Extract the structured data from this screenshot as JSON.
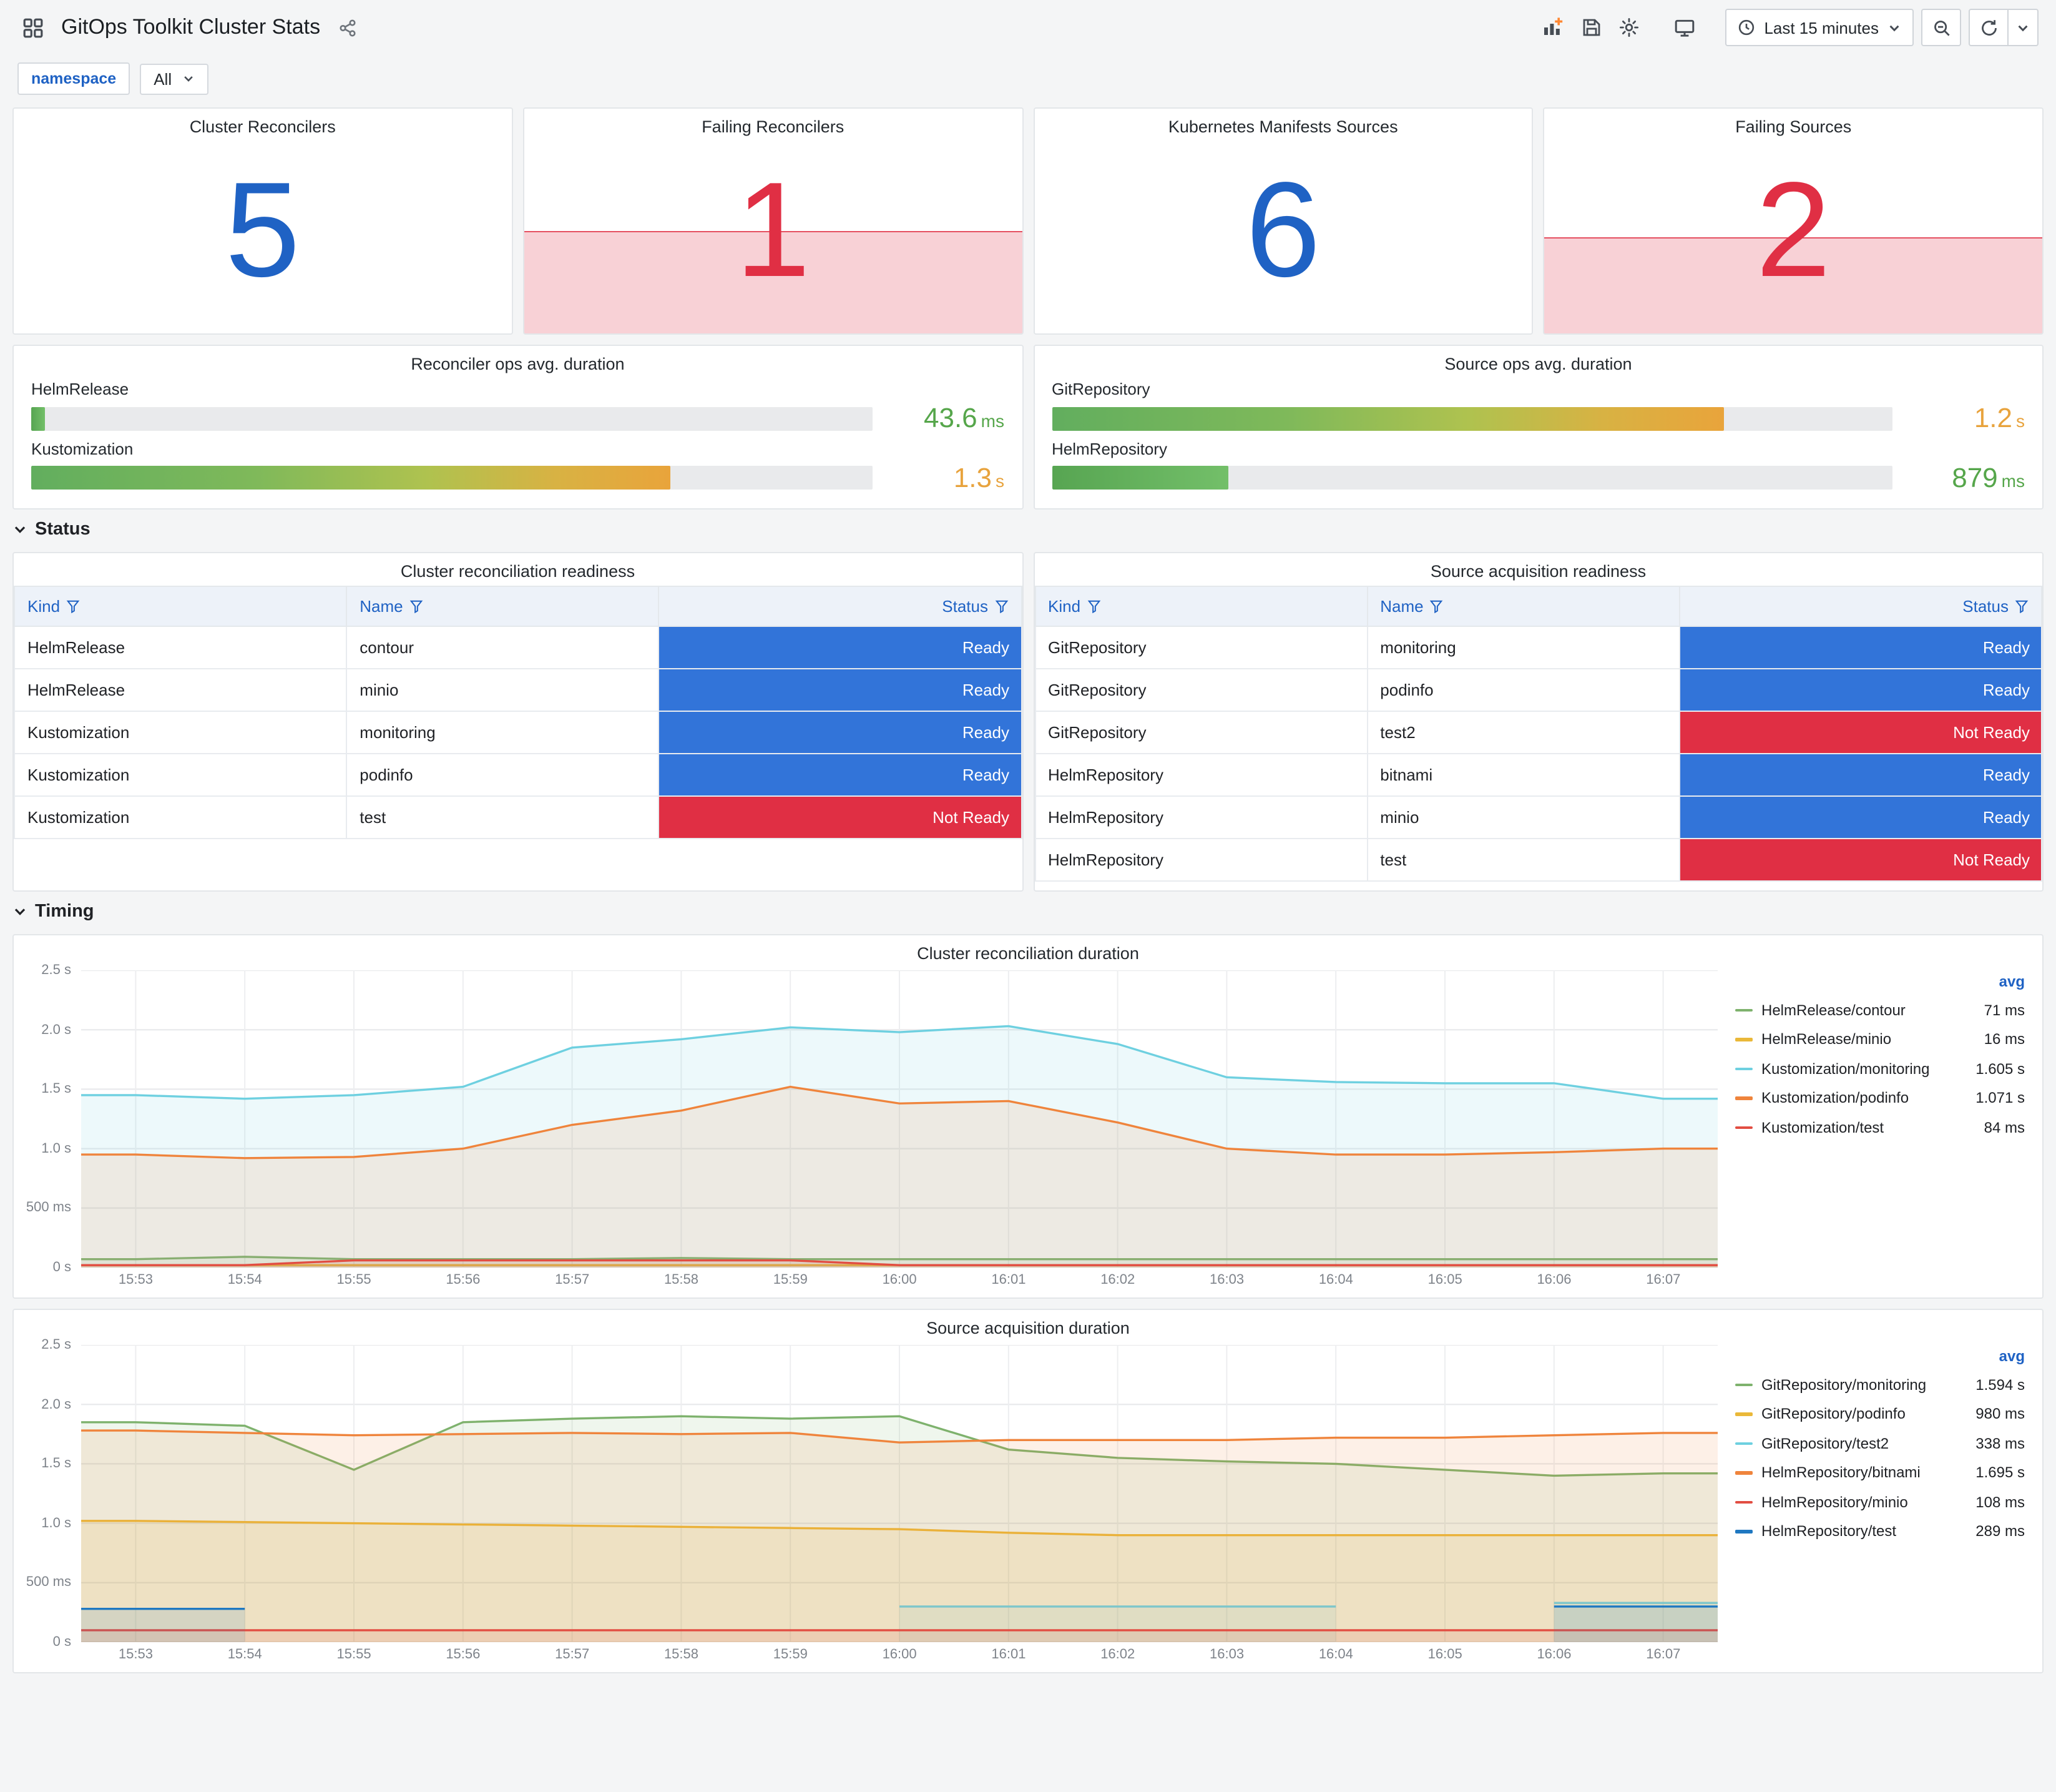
{
  "header": {
    "title": "GitOps Toolkit Cluster Stats",
    "time_picker": {
      "label": "Last 15 minutes"
    }
  },
  "variables": {
    "namespace_label": "namespace",
    "namespace_value": "All"
  },
  "stats": [
    {
      "title": "Cluster Reconcilers",
      "value": "5",
      "color": "#1F62C4",
      "spark": null
    },
    {
      "title": "Failing Reconcilers",
      "value": "1",
      "color": "#E02F44",
      "spark": 0.45
    },
    {
      "title": "Kubernetes Manifests Sources",
      "value": "6",
      "color": "#1F62C4",
      "spark": null
    },
    {
      "title": "Failing Sources",
      "value": "2",
      "color": "#E02F44",
      "spark": 0.42
    }
  ],
  "gauges": {
    "left": {
      "title": "Reconciler ops avg. duration",
      "bars": [
        {
          "label": "HelmRelease",
          "value": "43.6",
          "unit": "ms",
          "pct": 1.6,
          "value_color": "#56A64B",
          "gradient": false
        },
        {
          "label": "Kustomization",
          "value": "1.3",
          "unit": "s",
          "pct": 76,
          "value_color": "#E8A33D",
          "gradient": true
        }
      ]
    },
    "right": {
      "title": "Source ops avg. duration",
      "bars": [
        {
          "label": "GitRepository",
          "value": "1.2",
          "unit": "s",
          "pct": 80,
          "value_color": "#E8A33D",
          "gradient": true
        },
        {
          "label": "HelmRepository",
          "value": "879",
          "unit": "ms",
          "pct": 21,
          "value_color": "#56A64B",
          "gradient": false
        }
      ]
    }
  },
  "sections": {
    "status": "Status",
    "timing": "Timing"
  },
  "status_colors": {
    "Ready": "#3274D9",
    "Not Ready": "#E02F44"
  },
  "tables": [
    {
      "title": "Cluster reconciliation readiness",
      "columns": [
        "Kind",
        "Name",
        "Status"
      ],
      "rows": [
        {
          "kind": "HelmRelease",
          "name": "contour",
          "status": "Ready"
        },
        {
          "kind": "HelmRelease",
          "name": "minio",
          "status": "Ready"
        },
        {
          "kind": "Kustomization",
          "name": "monitoring",
          "status": "Ready"
        },
        {
          "kind": "Kustomization",
          "name": "podinfo",
          "status": "Ready"
        },
        {
          "kind": "Kustomization",
          "name": "test",
          "status": "Not Ready"
        }
      ]
    },
    {
      "title": "Source acquisition readiness",
      "columns": [
        "Kind",
        "Name",
        "Status"
      ],
      "rows": [
        {
          "kind": "GitRepository",
          "name": "monitoring",
          "status": "Ready"
        },
        {
          "kind": "GitRepository",
          "name": "podinfo",
          "status": "Ready"
        },
        {
          "kind": "GitRepository",
          "name": "test2",
          "status": "Not Ready"
        },
        {
          "kind": "HelmRepository",
          "name": "bitnami",
          "status": "Ready"
        },
        {
          "kind": "HelmRepository",
          "name": "minio",
          "status": "Ready"
        },
        {
          "kind": "HelmRepository",
          "name": "test",
          "status": "Not Ready"
        }
      ]
    }
  ],
  "chart_data": [
    {
      "type": "area",
      "title": "Cluster reconciliation duration",
      "x": [
        "15:53",
        "15:54",
        "15:55",
        "15:56",
        "15:57",
        "15:58",
        "15:59",
        "16:00",
        "16:01",
        "16:02",
        "16:03",
        "16:04",
        "16:05",
        "16:06",
        "16:07"
      ],
      "ylim": [
        0,
        2.5
      ],
      "ytick_values": [
        0,
        0.5,
        1.0,
        1.5,
        2.0,
        2.5
      ],
      "yticks": [
        "0 s",
        "500 ms",
        "1.0 s",
        "1.5 s",
        "2.0 s",
        "2.5 s"
      ],
      "legend_header": "avg",
      "fill_opacity": 0.12,
      "grid": true,
      "legend_position": "right",
      "series": [
        {
          "name": "HelmRelease/contour",
          "color": "#7EB26D",
          "avg": "71 ms",
          "values": [
            0.07,
            0.09,
            0.07,
            0.07,
            0.07,
            0.08,
            0.07,
            0.07,
            0.07,
            0.07,
            0.07,
            0.07,
            0.07,
            0.07,
            0.07
          ]
        },
        {
          "name": "HelmRelease/minio",
          "color": "#EAB839",
          "avg": "16 ms",
          "values": [
            0.02,
            0.02,
            0.02,
            0.02,
            0.02,
            0.02,
            0.02,
            0.02,
            0.02,
            0.02,
            0.02,
            0.02,
            0.02,
            0.02,
            0.02
          ]
        },
        {
          "name": "Kustomization/monitoring",
          "color": "#6ED0E0",
          "avg": "1.605 s",
          "values": [
            1.45,
            1.42,
            1.45,
            1.52,
            1.85,
            1.92,
            2.02,
            1.98,
            2.03,
            1.88,
            1.6,
            1.56,
            1.55,
            1.55,
            1.42
          ]
        },
        {
          "name": "Kustomization/podinfo",
          "color": "#EF843C",
          "avg": "1.071 s",
          "values": [
            0.95,
            0.92,
            0.93,
            1.0,
            1.2,
            1.32,
            1.52,
            1.38,
            1.4,
            1.22,
            1.0,
            0.95,
            0.95,
            0.97,
            1.0
          ]
        },
        {
          "name": "Kustomization/test",
          "color": "#E24D42",
          "avg": "84 ms",
          "values": [
            0.02,
            0.02,
            0.06,
            0.06,
            0.06,
            0.06,
            0.06,
            0.02,
            0.02,
            0.02,
            0.02,
            0.02,
            0.02,
            0.02,
            0.02
          ]
        }
      ]
    },
    {
      "type": "area",
      "title": "Source acquisition duration",
      "x": [
        "15:53",
        "15:54",
        "15:55",
        "15:56",
        "15:57",
        "15:58",
        "15:59",
        "16:00",
        "16:01",
        "16:02",
        "16:03",
        "16:04",
        "16:05",
        "16:06",
        "16:07"
      ],
      "ylim": [
        0,
        2.5
      ],
      "ytick_values": [
        0,
        0.5,
        1.0,
        1.5,
        2.0,
        2.5
      ],
      "yticks": [
        "0 s",
        "500 ms",
        "1.0 s",
        "1.5 s",
        "2.0 s",
        "2.5 s"
      ],
      "legend_header": "avg",
      "fill_opacity": 0.12,
      "grid": true,
      "legend_position": "right",
      "series": [
        {
          "name": "GitRepository/monitoring",
          "color": "#7EB26D",
          "avg": "1.594 s",
          "values": [
            1.85,
            1.82,
            1.45,
            1.85,
            1.88,
            1.9,
            1.88,
            1.9,
            1.62,
            1.55,
            1.52,
            1.5,
            1.45,
            1.4,
            1.42
          ]
        },
        {
          "name": "GitRepository/podinfo",
          "color": "#EAB839",
          "avg": "980 ms",
          "values": [
            1.02,
            1.01,
            1.0,
            0.99,
            0.98,
            0.97,
            0.96,
            0.95,
            0.92,
            0.9,
            0.9,
            0.9,
            0.9,
            0.9,
            0.9
          ]
        },
        {
          "name": "GitRepository/test2",
          "color": "#6ED0E0",
          "avg": "338 ms",
          "values": [
            null,
            null,
            null,
            null,
            null,
            null,
            null,
            0.3,
            0.3,
            0.3,
            0.3,
            0.3,
            null,
            0.33,
            0.33
          ]
        },
        {
          "name": "HelmRepository/bitnami",
          "color": "#EF843C",
          "avg": "1.695 s",
          "values": [
            1.78,
            1.76,
            1.74,
            1.75,
            1.76,
            1.75,
            1.76,
            1.68,
            1.7,
            1.7,
            1.7,
            1.72,
            1.72,
            1.74,
            1.76
          ]
        },
        {
          "name": "HelmRepository/minio",
          "color": "#E24D42",
          "avg": "108 ms",
          "values": [
            0.1,
            0.1,
            0.1,
            0.1,
            0.1,
            0.1,
            0.1,
            0.1,
            0.1,
            0.1,
            0.1,
            0.1,
            0.1,
            0.1,
            0.1
          ]
        },
        {
          "name": "HelmRepository/test",
          "color": "#1F78C1",
          "avg": "289 ms",
          "values": [
            0.28,
            0.28,
            null,
            null,
            null,
            null,
            null,
            null,
            null,
            null,
            null,
            null,
            null,
            0.3,
            0.3
          ]
        }
      ]
    }
  ]
}
